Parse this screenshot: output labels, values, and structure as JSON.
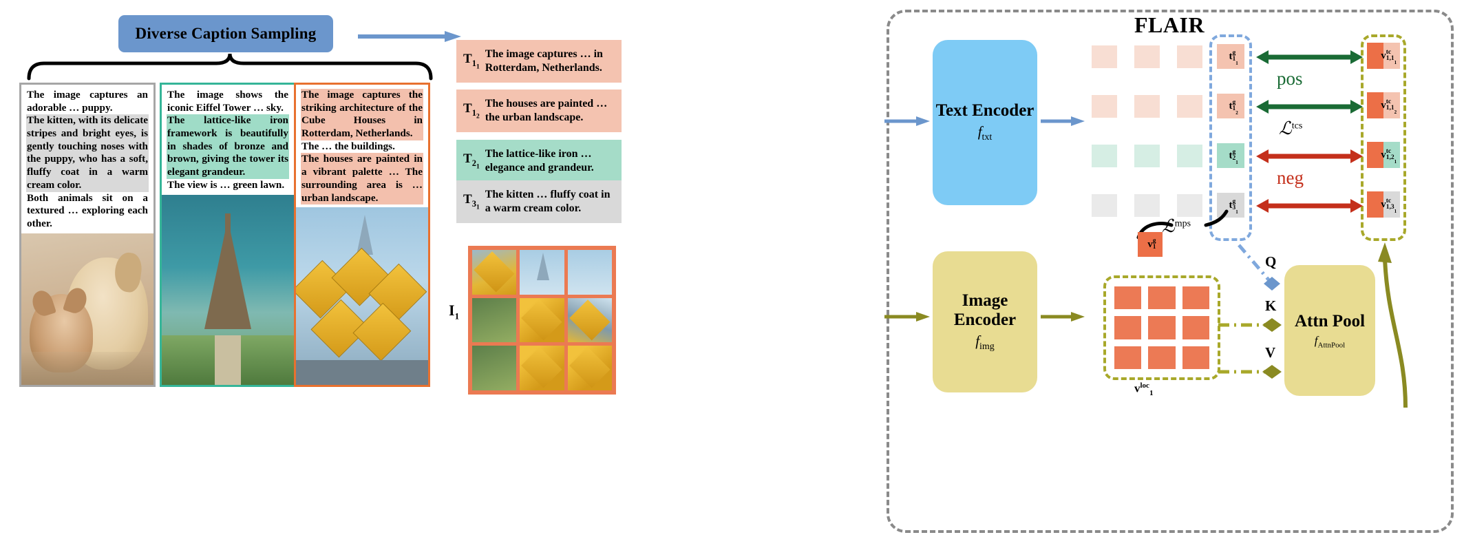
{
  "banner": {
    "title": "Diverse Caption Sampling"
  },
  "caption_cards": [
    {
      "name": "kitten-puppy-caption",
      "border_color": "#a6a6a6",
      "segments": [
        {
          "text": "The image captures an adorable … puppy.",
          "highlight": "none"
        },
        {
          "text": "The kitten, with its delicate stripes and bright eyes, is gently touching noses with the puppy, who has a soft, fluffy coat in a warm cream color.",
          "highlight": "gray"
        },
        {
          "text": "Both animals sit on a textured … exploring each other.",
          "highlight": "none"
        }
      ],
      "photo": "kitten-and-puppy-photo"
    },
    {
      "name": "eiffel-tower-caption",
      "border_color": "#35b598",
      "segments": [
        {
          "text": "The image shows the iconic Eiffel Tower … sky.",
          "highlight": "none"
        },
        {
          "text": "The lattice-like iron framework is beautifully in shades of bronze and brown, giving the tower its elegant grandeur.",
          "highlight": "green"
        },
        {
          "text": "The view is … green lawn.",
          "highlight": "none"
        }
      ],
      "photo": "eiffel-tower-photo"
    },
    {
      "name": "cube-houses-caption",
      "border_color": "#e8712f",
      "segments": [
        {
          "text": "The image captures the striking architecture of the Cube Houses in Rotterdam, Netherlands.",
          "highlight": "peach"
        },
        {
          "text": "The … the buildings.",
          "highlight": "none"
        },
        {
          "text": "The houses are painted in a vibrant palette … The surrounding area is … urban landscape.",
          "highlight": "peach"
        }
      ],
      "photo": "cube-houses-photo"
    }
  ],
  "sampled_texts": [
    {
      "tag": "T",
      "sub": "1",
      "subsub": "1",
      "text": "The image captures … in Rotterdam, Netherlands.",
      "color": "peach"
    },
    {
      "tag": "T",
      "sub": "1",
      "subsub": "2",
      "text": "The houses are painted … the urban landscape.",
      "color": "peach"
    },
    {
      "tag": "T",
      "sub": "2",
      "subsub": "1",
      "text": "The lattice-like iron … elegance and grandeur.",
      "color": "green"
    },
    {
      "tag": "T",
      "sub": "3",
      "subsub": "1",
      "text": "The kitten … fluffy coat in a warm cream color.",
      "color": "gray"
    }
  ],
  "image_input": {
    "label": "I",
    "sub": "1"
  },
  "flair": {
    "title": "FLAIR",
    "text_encoder": {
      "name": "Text Encoder",
      "fn": "f",
      "fn_sub": "txt"
    },
    "image_encoder": {
      "name": "Image Encoder",
      "fn": "f",
      "fn_sub": "img"
    },
    "attn_pool": {
      "name": "Attn Pool",
      "fn": "f",
      "fn_sub": "AttnPool"
    },
    "qkv": {
      "q": "Q",
      "k": "K",
      "v": "V"
    },
    "text_tokens": [
      {
        "base": "t",
        "sup": "g",
        "sub": "1",
        "subsub": "1",
        "color": "peach"
      },
      {
        "base": "t",
        "sup": "g",
        "sub": "1",
        "subsub": "2",
        "color": "peach"
      },
      {
        "base": "t",
        "sup": "g",
        "sub": "2",
        "subsub": "1",
        "color": "green"
      },
      {
        "base": "t",
        "sup": "g",
        "sub": "3",
        "subsub": "1",
        "color": "gray"
      }
    ],
    "vtc_tokens": [
      {
        "base": "v",
        "sup": "tc",
        "sub": "1,1",
        "subsub": "1",
        "style": "peach-peach"
      },
      {
        "base": "v",
        "sup": "tc",
        "sub": "1,1",
        "subsub": "2",
        "style": "peach-peach"
      },
      {
        "base": "v",
        "sup": "tc",
        "sub": "1,2",
        "subsub": "1",
        "style": "peach-green"
      },
      {
        "base": "v",
        "sup": "tc",
        "sub": "1,3",
        "subsub": "1",
        "style": "peach-gray"
      }
    ],
    "relations": [
      {
        "label": "pos",
        "color": "#1a6b35"
      },
      {
        "label": "neg",
        "color": "#c42f1b"
      }
    ],
    "losses": [
      {
        "symbol": "L",
        "sup": "tcs"
      },
      {
        "symbol": "L",
        "sup": "mps"
      }
    ],
    "global_image_token": {
      "base": "v",
      "sup": "g",
      "sub": "1"
    },
    "local_features_label": {
      "base": "v",
      "sup": "loc",
      "sub": "1"
    }
  },
  "colors": {
    "banner_blue": "#6b96cc",
    "text_encoder_blue": "#7ecbf5",
    "encoder_yellow": "#e8dc92",
    "peach": "#f4c3b0",
    "strong_orange": "#ec6f47",
    "green": "#a5dcc8",
    "gray": "#d9d9d9",
    "pos_green": "#1a6b35",
    "neg_red": "#c42f1b",
    "olive_dash": "#a8a82a",
    "blue_dash": "#7fa8dd",
    "flair_border": "#8a8a8a"
  }
}
